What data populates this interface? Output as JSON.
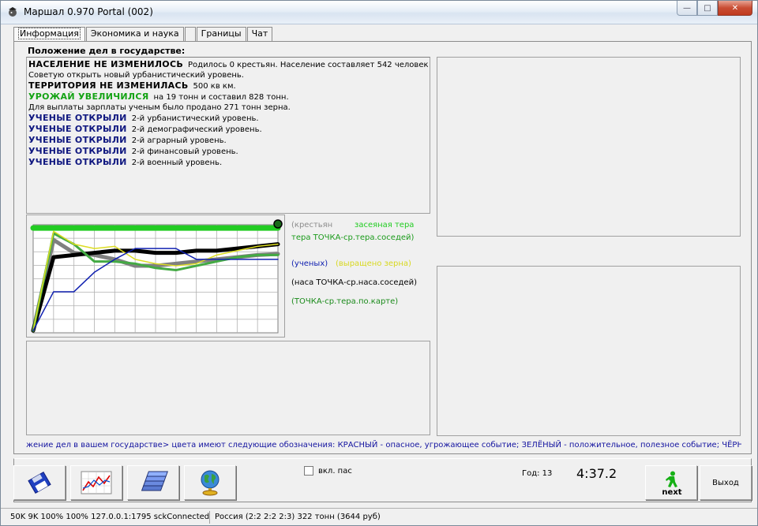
{
  "window": {
    "title": "Маршал 0.970   Portal (002)",
    "controls": {
      "minimize": "—",
      "maximize": "□",
      "close": "✕"
    }
  },
  "tabs": [
    {
      "label": "Информация",
      "active": true
    },
    {
      "label": "Экономика и наука",
      "active": false
    },
    {
      "label": "",
      "active": false
    },
    {
      "label": "Границы",
      "active": false
    },
    {
      "label": "Чат",
      "active": false
    }
  ],
  "report": {
    "heading": "Положение дел в государстве:",
    "lines": [
      {
        "highlight": "НАСЕЛЕНИЕ НЕ ИЗМЕНИЛОСЬ",
        "color": "black",
        "text": "Родилось 0 крестьян. Население составляет 542 человек."
      },
      {
        "highlight": "",
        "color": "",
        "text": "Советую открыть новый урбанистический уровень."
      },
      {
        "highlight": "ТЕРРИТОРИЯ НЕ ИЗМЕНИЛАСЬ",
        "color": "black",
        "text": "500 кв км."
      },
      {
        "highlight": "УРОЖАЙ УВЕЛИЧИЛСЯ",
        "color": "green",
        "text": "на 19 тонн и составил 828 тонн."
      },
      {
        "highlight": "",
        "color": "",
        "text": "Для выплаты зарплаты ученым  было продано 271 тонн зерна."
      },
      {
        "highlight": "УЧЕНЫЕ ОТКРЫЛИ",
        "color": "navy",
        "text": "2-й урбанистический уровень."
      },
      {
        "highlight": "УЧЕНЫЕ ОТКРЫЛИ",
        "color": "navy",
        "text": "2-й демографический уровень."
      },
      {
        "highlight": "УЧЕНЫЕ ОТКРЫЛИ",
        "color": "navy",
        "text": "2-й аграрный уровень."
      },
      {
        "highlight": "УЧЕНЫЕ ОТКРЫЛИ",
        "color": "navy",
        "text": "2-й финансовый уровень."
      },
      {
        "highlight": "УЧЕНЫЕ ОТКРЫЛИ",
        "color": "navy",
        "text": "2-й военный уровень."
      }
    ]
  },
  "legend": {
    "peasants": "(крестьян",
    "sown_land": "засеяная тера",
    "land": "тера  ТОЧКА-ср.тера.соседей)",
    "scientists": "(ученых)",
    "grain_grown": "(выращено зерна)",
    "population": "(наса  ТОЧКА-ср.наса.соседей)",
    "map_land": "(ТОЧКА-ср.тера.по.карте)"
  },
  "chart_data": {
    "type": "line",
    "x": [
      1,
      2,
      3,
      4,
      5,
      6,
      7,
      8,
      9,
      10,
      11,
      12,
      13
    ],
    "ylim": [
      0,
      1
    ],
    "grid": true,
    "series": [
      {
        "color": "#22cc22",
        "values": [
          0.97,
          0.97,
          0.97,
          0.97,
          0.97,
          0.97,
          0.97,
          0.97,
          0.97,
          0.97,
          0.97,
          0.97,
          0.97
        ]
      },
      {
        "color": "#808080",
        "values": [
          0.02,
          0.86,
          0.74,
          0.72,
          0.68,
          0.62,
          0.62,
          0.64,
          0.66,
          0.68,
          0.7,
          0.72,
          0.73
        ]
      },
      {
        "color": "#000000",
        "values": [
          0.02,
          0.7,
          0.72,
          0.74,
          0.76,
          0.76,
          0.74,
          0.74,
          0.76,
          0.76,
          0.78,
          0.8,
          0.82
        ]
      },
      {
        "color": "#44aa44",
        "values": [
          0.02,
          0.92,
          0.82,
          0.66,
          0.66,
          0.64,
          0.6,
          0.58,
          0.62,
          0.66,
          0.7,
          0.72,
          0.72
        ]
      },
      {
        "color": "#dddd22",
        "values": [
          0.02,
          0.94,
          0.82,
          0.78,
          0.8,
          0.68,
          0.64,
          0.62,
          0.64,
          0.72,
          0.76,
          0.8,
          0.82
        ]
      },
      {
        "color": "#1020b0",
        "values": [
          0.02,
          0.38,
          0.38,
          0.56,
          0.68,
          0.78,
          0.78,
          0.78,
          0.68,
          0.68,
          0.68,
          0.68,
          0.68
        ]
      }
    ]
  },
  "ticker": "жение дел в вашем государстве> цвета имеют следующие обозначения: КРАСНЫЙ - опасное, угрожающее событие; ЗЕЛЁНЫЙ - положительное, полезное событие; ЧЁРНЫЙ -",
  "controls": {
    "pass_label": "вкл. пас",
    "year": "Год: 13",
    "clock": "4:37.2",
    "next": "next",
    "exit": "Выход"
  },
  "status": {
    "speeds": "50K  9K  100%  100%  127.0.0.1:1795  sckConnected",
    "country": "Россия (2:2  2:2  2:3)  322 тонн (3644 руб)"
  }
}
